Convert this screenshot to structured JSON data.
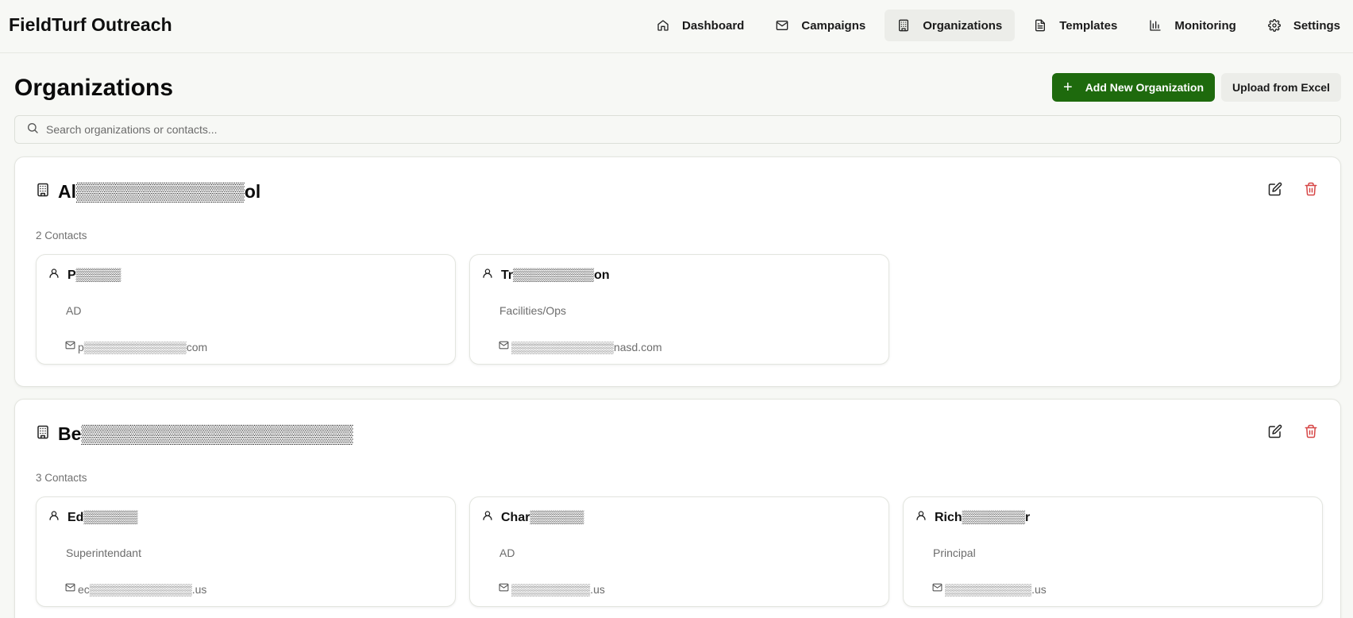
{
  "app": {
    "title": "FieldTurf Outreach"
  },
  "nav": [
    {
      "label": "Dashboard",
      "icon": "home-icon",
      "active": false
    },
    {
      "label": "Campaigns",
      "icon": "mail-icon",
      "active": false
    },
    {
      "label": "Organizations",
      "icon": "building-icon",
      "active": true
    },
    {
      "label": "Templates",
      "icon": "file-text-icon",
      "active": false
    },
    {
      "label": "Monitoring",
      "icon": "bar-chart-icon",
      "active": false
    },
    {
      "label": "Settings",
      "icon": "gear-icon",
      "active": false
    }
  ],
  "page": {
    "title": "Organizations",
    "add_button": "Add New Organization",
    "upload_button": "Upload from Excel"
  },
  "search": {
    "placeholder": "Search organizations or contacts...",
    "value": ""
  },
  "colors": {
    "primary": "#1e6a0d",
    "delete": "#d64545",
    "background": "#f7f8f5"
  },
  "organizations": [
    {
      "name": "Al▒▒▒▒▒▒▒▒▒▒▒▒▒ol",
      "contact_count": "2 Contacts",
      "contacts": [
        {
          "name": "P▒▒▒▒▒",
          "role": "AD",
          "email": "p▒▒▒▒▒▒▒▒▒▒▒▒▒com"
        },
        {
          "name": "Tr▒▒▒▒▒▒▒▒▒on",
          "role": "Facilities/Ops",
          "email": "▒▒▒▒▒▒▒▒▒▒▒▒▒nasd.com"
        }
      ]
    },
    {
      "name": "Be▒▒▒▒▒▒▒▒▒▒▒▒▒▒▒▒▒▒▒▒▒",
      "contact_count": "3 Contacts",
      "contacts": [
        {
          "name": "Ed▒▒▒▒▒▒",
          "role": "Superintendant",
          "email": "ec▒▒▒▒▒▒▒▒▒▒▒▒▒.us"
        },
        {
          "name": "Char▒▒▒▒▒▒",
          "role": "AD",
          "email": "▒▒▒▒▒▒▒▒▒▒.us"
        },
        {
          "name": "Rich▒▒▒▒▒▒▒r",
          "role": "Principal",
          "email": "▒▒▒▒▒▒▒▒▒▒▒.us"
        }
      ]
    }
  ]
}
